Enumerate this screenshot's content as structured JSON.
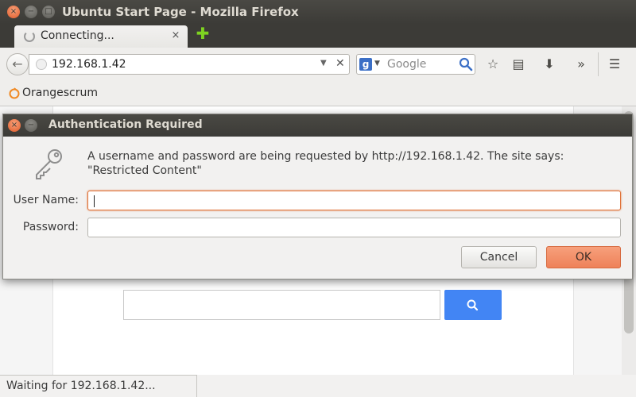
{
  "window": {
    "title": "Ubuntu Start Page - Mozilla Firefox",
    "close_glyph": "×",
    "minimize_glyph": "−",
    "maximize_glyph": "□"
  },
  "tabs": [
    {
      "label": "Connecting...",
      "close_glyph": "×",
      "loading": true
    }
  ],
  "new_tab_glyph": "✚",
  "navbar": {
    "back_glyph": "←",
    "url": "192.168.1.42",
    "url_dropdown_glyph": "▼",
    "url_clear_glyph": "✕",
    "search_engine_glyph": "g",
    "search_dropdown_glyph": "▼",
    "search_placeholder": "Google",
    "bookmark_glyph": "☆",
    "reading_list_glyph": "▤",
    "downloads_glyph": "⬇",
    "overflow_glyph": "»",
    "menu_glyph": "☰"
  },
  "bookmarks": [
    {
      "label": "Orangescrum"
    }
  ],
  "status": {
    "text": "Waiting for 192.168.1.42..."
  },
  "dialog": {
    "title": "Authentication Required",
    "close_glyph": "×",
    "minimize_glyph": "−",
    "message": "A username and password are being requested by http://192.168.1.42. The site says: \"Restricted Content\"",
    "username_label": "User Name:",
    "username_value": "",
    "password_label": "Password:",
    "password_value": "",
    "cancel_label": "Cancel",
    "ok_label": "OK"
  },
  "colors": {
    "titlebar": "#3c3b37",
    "accent_orange": "#ee8159",
    "focus_ring": "#e0743c",
    "google_blue": "#4285f4"
  }
}
